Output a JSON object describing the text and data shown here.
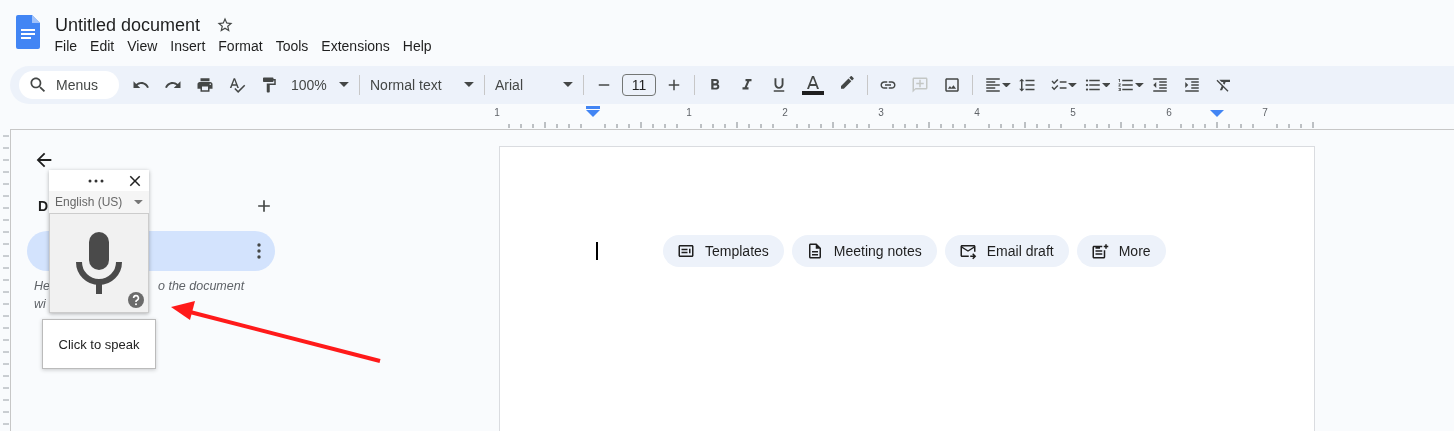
{
  "document": {
    "title": "Untitled document"
  },
  "menu": [
    "File",
    "Edit",
    "View",
    "Insert",
    "Format",
    "Tools",
    "Extensions",
    "Help"
  ],
  "toolbar": {
    "search": {
      "placeholder": "Menus"
    },
    "zoom": "100%",
    "style": "Normal text",
    "font": "Arial",
    "font_size": "11",
    "insert_comment": {
      "disabled": true
    }
  },
  "ruler": {
    "labels": [
      "1",
      "1",
      "2",
      "3",
      "4",
      "5",
      "6",
      "7"
    ]
  },
  "sidebar": {
    "heading": "D",
    "hint_lines": [
      [
        "He",
        "o the document"
      ],
      [
        "wi"
      ]
    ]
  },
  "voice_typing": {
    "language": "English (US)",
    "tooltip": "Click to speak"
  },
  "page": {
    "chips": [
      {
        "label": "Templates"
      },
      {
        "label": "Meeting notes"
      },
      {
        "label": "Email draft"
      },
      {
        "label": "More"
      }
    ]
  }
}
